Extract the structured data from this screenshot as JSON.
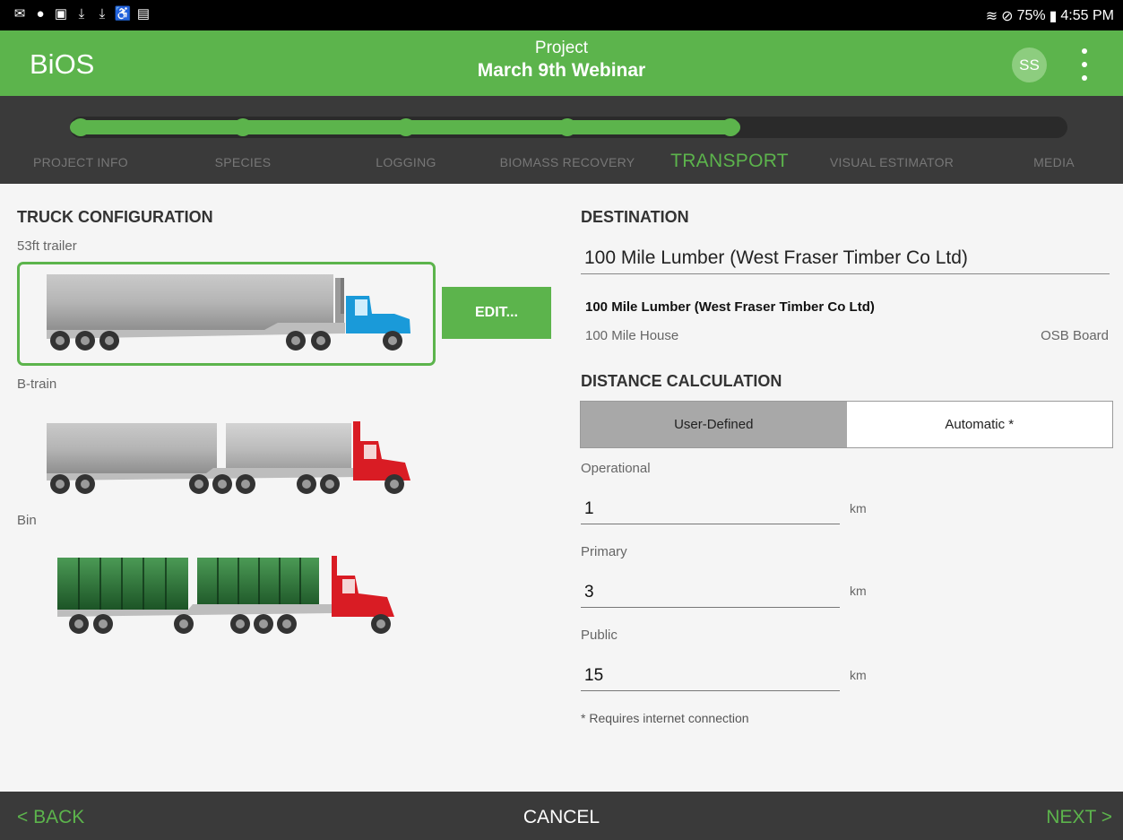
{
  "status_bar": {
    "left_icons": [
      "mail-icon",
      "bag-icon",
      "image-icon",
      "download-icon",
      "download-icon",
      "accessibility-icon",
      "file-icon"
    ],
    "right_icons": [
      "wifi-icon",
      "do-not-disturb-icon",
      "battery-icon"
    ],
    "battery": "75%",
    "time": "4:55 PM"
  },
  "app_bar": {
    "title": "BiOS",
    "subtitle": "Project",
    "project_name": "March 9th Webinar",
    "avatar_initials": "SS",
    "brand_color": "#5cb44c"
  },
  "steps": {
    "items": [
      {
        "label": "PROJECT INFO",
        "state": "done"
      },
      {
        "label": "SPECIES",
        "state": "done"
      },
      {
        "label": "LOGGING",
        "state": "done"
      },
      {
        "label": "BIOMASS RECOVERY",
        "state": "done"
      },
      {
        "label": "TRANSPORT",
        "state": "active"
      },
      {
        "label": "VISUAL ESTIMATOR",
        "state": "todo"
      },
      {
        "label": "MEDIA",
        "state": "todo"
      }
    ]
  },
  "truck_config": {
    "title": "TRUCK CONFIGURATION",
    "options": [
      {
        "label": "53ft trailer",
        "selected": true,
        "cab_color": "#1a9ad9"
      },
      {
        "label": "B-train",
        "selected": false,
        "cab_color": "#d91c24"
      },
      {
        "label": "Bin",
        "selected": false,
        "cab_color": "#d91c24"
      }
    ],
    "edit_label": "EDIT..."
  },
  "destination": {
    "title": "DESTINATION",
    "value": "100 Mile Lumber (West Fraser Timber Co Ltd)",
    "name": "100 Mile Lumber (West Fraser Timber Co Ltd)",
    "location": "100 Mile House",
    "type": "OSB Board"
  },
  "distance": {
    "title": "DISTANCE CALCULATION",
    "tabs": [
      "User-Defined",
      "Automatic *"
    ],
    "selected_tab": "User-Defined",
    "fields": [
      {
        "label": "Operational",
        "value": "1",
        "unit": "km"
      },
      {
        "label": "Primary",
        "value": "3",
        "unit": "km"
      },
      {
        "label": "Public",
        "value": "15",
        "unit": "km"
      }
    ],
    "note": "* Requires internet connection"
  },
  "bottom_bar": {
    "back": "< BACK",
    "cancel": "CANCEL",
    "next": "NEXT >"
  }
}
